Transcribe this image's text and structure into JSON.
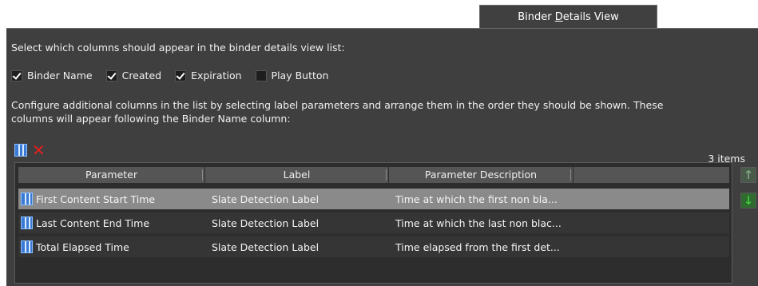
{
  "tab": {
    "label_pre": "Binder ",
    "label_ul": "D",
    "label_post": "etails View"
  },
  "intro_text": "Select which columns should appear in the binder details view list:",
  "checkboxes": [
    {
      "label": "Binder Name",
      "checked": true
    },
    {
      "label": "Created",
      "checked": true
    },
    {
      "label": "Expiration",
      "checked": true
    },
    {
      "label": "Play Button",
      "checked": false
    }
  ],
  "configure_text_line1": "Configure additional columns in the list by selecting label parameters and arrange them in the order they should be shown. These",
  "configure_text_line2": "columns will appear following the Binder Name column:",
  "toolbar": {
    "add_icon": "columns-icon",
    "delete_icon": "close-icon"
  },
  "item_count": "3 items",
  "grid": {
    "headers": [
      "Parameter",
      "Label",
      "Parameter Description",
      ""
    ],
    "rows": [
      {
        "parameter": "First Content Start Time",
        "label": "Slate Detection Label",
        "description": "Time at which the first non bla...",
        "selected": true
      },
      {
        "parameter": "Last Content End Time",
        "label": "Slate Detection Label",
        "description": "Time at which the last non blac...",
        "selected": false
      },
      {
        "parameter": "Total Elapsed Time",
        "label": "Slate Detection Label",
        "description": "Time elapsed from the first det...",
        "selected": false
      }
    ]
  },
  "move_up_icon": "arrow-up-icon",
  "move_down_icon": "arrow-down-icon",
  "colors": {
    "panel": "#3f3f3f",
    "selected_row": "#8a8a8a",
    "accent_green": "#3ec83e",
    "delete_red": "#e02020"
  }
}
